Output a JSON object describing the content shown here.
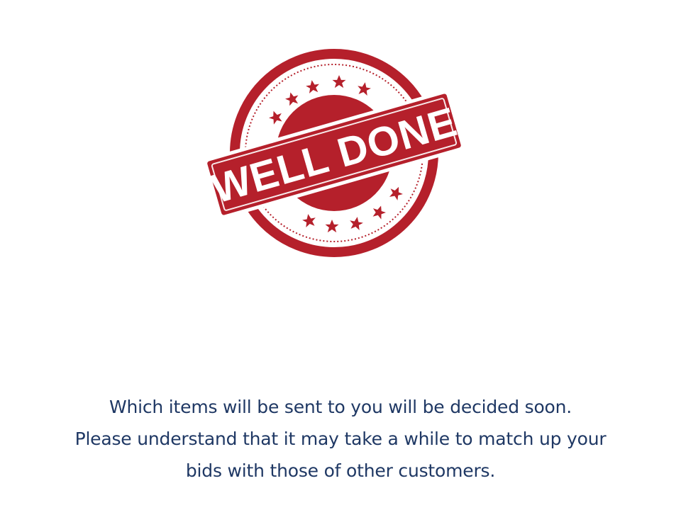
{
  "stamp": {
    "text": "WELL DONE",
    "color": "#b5202b"
  },
  "message": {
    "lines": [
      "Which items will be sent to you will be decided soon.",
      "Please understand that it may take a while to match up your",
      "bids with those of other customers."
    ],
    "color": "#1f3864"
  }
}
